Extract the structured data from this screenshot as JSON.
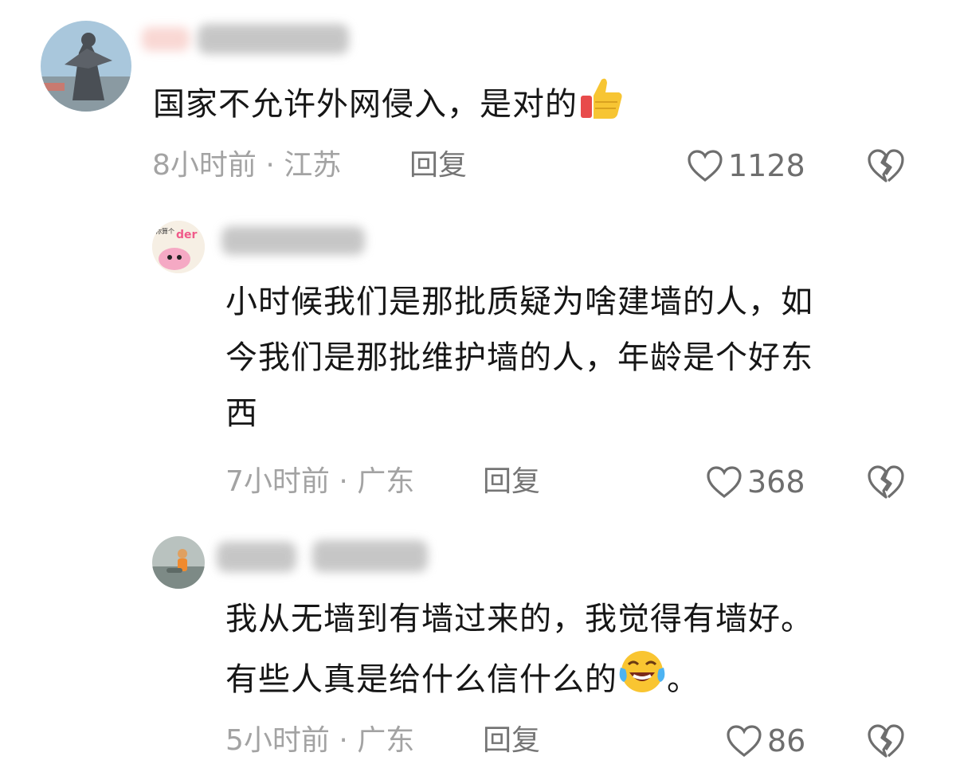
{
  "comments": [
    {
      "text": "国家不允许外网侵入，是对的",
      "emoji": "thumbs-up",
      "time": "8小时前",
      "location": "江苏",
      "reply_label": "回复",
      "likes": "1128"
    },
    {
      "avatar_text": "der",
      "avatar_caption": "你算个",
      "text_lines": [
        "小时候我们是那批质疑为啥建墙的人，如",
        "今我们是那批维护墙的人，年龄是个好东",
        "西"
      ],
      "time": "7小时前",
      "location": "广东",
      "reply_label": "回复",
      "likes": "368"
    },
    {
      "text_lines": [
        "我从无墙到有墙过来的，我觉得有墙好。",
        "有些人真是给什么信什么的"
      ],
      "emoji": "laughing-tears",
      "trailing": "。",
      "time": "5小时前",
      "location": "广东",
      "reply_label": "回复",
      "likes": "86"
    }
  ],
  "separator": "·",
  "colors": {
    "meta": "#a3a3a3",
    "text": "#161616",
    "reply": "#757575"
  }
}
